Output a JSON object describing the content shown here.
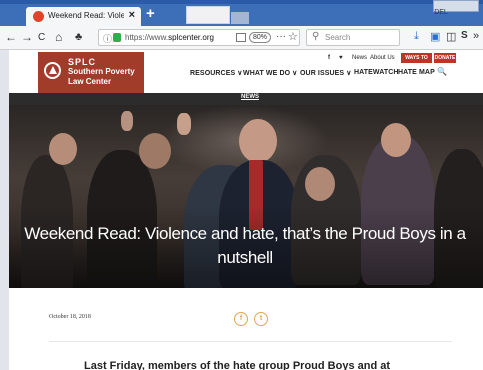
{
  "browser": {
    "tab_title": "Weekend Read: Violence and ha",
    "tab_close": "×",
    "new_tab": "+",
    "window_button": "DEL",
    "nav": {
      "back": "←",
      "forward": "→",
      "reload": "C",
      "home": "⌂",
      "extension": "♣"
    },
    "url_prefix": "https://www.",
    "url_domain": "splcenter.org",
    "zoom": "80%",
    "page_actions": "···",
    "bookmark": "☆",
    "search_placeholder": "Search",
    "toolbar_icons": {
      "download": "⤓",
      "library": "▣",
      "sidebar": "◫",
      "extension": "S",
      "overflow": "»"
    }
  },
  "site": {
    "logo": {
      "line1": "SPLC",
      "line2": "Southern Poverty",
      "line3": "Law Center"
    },
    "toplinks": {
      "facebook": "f",
      "twitter": "♥",
      "news": "News",
      "about": "About Us",
      "ways_to_give": "WAYS TO GIVE",
      "donate": "DONATE"
    },
    "nav": {
      "resources": "RESOURCES ∨",
      "what_we_do": "WHAT WE DO ∨",
      "our_issues": "OUR ISSUES ∨",
      "hatewatch": "HATEWATCH",
      "hate_map": "HATE MAP",
      "search": "🔍"
    },
    "section": "NEWS"
  },
  "article": {
    "title": "Weekend Read: Violence and hate, that’s the Proud Boys in a nutshell",
    "date": "October 18, 2018",
    "share": {
      "facebook": "f",
      "twitter": "t"
    },
    "lede": "Last Friday, members of the hate group Proud Boys and at"
  },
  "colors": {
    "brand": "#a13b2a",
    "accent": "#e0a84c",
    "browser": "#3d6fb8"
  }
}
